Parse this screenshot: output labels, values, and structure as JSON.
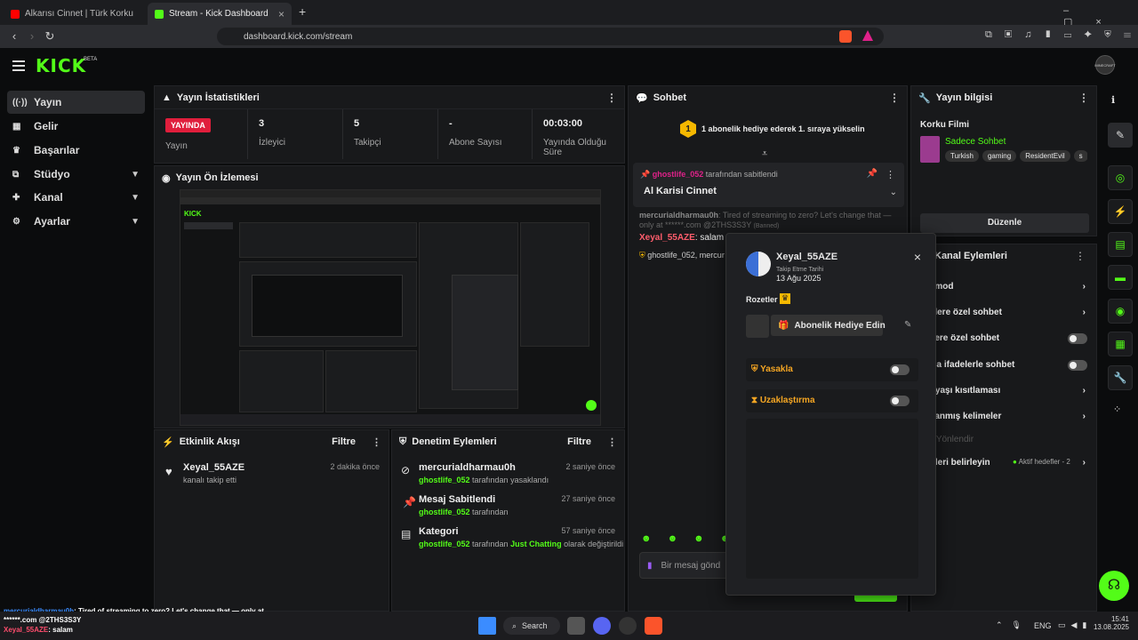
{
  "browser": {
    "tabs": [
      {
        "label": "Alkarısı Cinnet | Türk Korku Filmi Tek"
      },
      {
        "label": "Stream - Kick Dashboard"
      }
    ],
    "url": "dashboard.kick.com/stream",
    "new_tab": "+"
  },
  "header": {
    "logo": "KICK",
    "beta": "BETA",
    "avatar_label": "MINECRAFT"
  },
  "sidebar": {
    "items": [
      {
        "label": "Yayın",
        "icon": "broadcast-icon"
      },
      {
        "label": "Gelir",
        "icon": "revenue-icon"
      },
      {
        "label": "Başarılar",
        "icon": "trophy-icon"
      },
      {
        "label": "Stüdyo",
        "icon": "studio-icon"
      },
      {
        "label": "Kanal",
        "icon": "channel-icon"
      },
      {
        "label": "Ayarlar",
        "icon": "gear-icon"
      }
    ]
  },
  "stats": {
    "title": "Yayın İstatistikleri",
    "live": "YAYINDA",
    "live_label": "Yayın",
    "viewers": "3",
    "viewers_label": "İzleyici",
    "followers": "5",
    "followers_label": "Takipçi",
    "subs": "-",
    "subs_label": "Abone Sayısı",
    "duration": "00:03:00",
    "duration_label": "Yayında Olduğu Süre"
  },
  "preview": {
    "title": "Yayın Ön İzlemesi"
  },
  "activity": {
    "title": "Etkinlik Akışı",
    "filter": "Filtre",
    "items": [
      {
        "user": "Xeyal_55AZE",
        "desc": "kanalı takip etti",
        "time": "2 dakika önce"
      }
    ]
  },
  "moderation": {
    "title": "Denetim Eylemleri",
    "filter": "Filtre",
    "items": [
      {
        "title": "mercurialdharmau0h",
        "by": "ghostlife_052",
        "rest": " tarafından yasaklandı",
        "time": "2 saniye önce"
      },
      {
        "title": "Mesaj Sabitlendi",
        "by": "ghostlife_052",
        "rest": " tarafından",
        "time": "27 saniye önce"
      },
      {
        "title": "Kategori",
        "by": "ghostlife_052",
        "rest": " tarafından ",
        "category": "Just Chatting",
        "rest2": " olarak değiştirildi",
        "time": "57 saniye önce"
      }
    ]
  },
  "chat": {
    "title": "Sohbet",
    "gift_rank": "1",
    "gift_text": "1 abonelik hediye ederek 1. sıraya yükselin",
    "pinned_by": "ghostlife_052",
    "pinned_suffix": " tarafından sabitlendi",
    "pinned_msg": "Al Karisi Cinnet",
    "msg1_user": "mercurialdharmau0h",
    "msg1_text": ": Tired of streaming to zero? Let's change that — only at ******.com @2THS3S3Y",
    "msg1_tag": "(Banned)",
    "msg2_user": "Xeyal_55AZE",
    "msg2_text": ": salam",
    "msg3": "ghostlife_052, mercur",
    "input_placeholder": "Bir mesaj gönd"
  },
  "popup": {
    "user": "Xeyal_55AZE",
    "follow_label": "Takip Etme Tarihi",
    "follow_date": "13 Ağu 2025",
    "badges_label": "Rozetler",
    "gift_button": "Abonelik Hediye Edin",
    "ban": "Yasakla",
    "timeout": "Uzaklaştırma"
  },
  "streaminfo": {
    "title": "Yayın bilgisi",
    "stream_title": "Korku Filmi",
    "category": "Sadece Sohbet",
    "tags": [
      "Turkish",
      "gaming",
      "ResidentEvil",
      "s"
    ],
    "edit": "Düzenle"
  },
  "channel_actions": {
    "title": "Kanal Eylemleri",
    "items": [
      {
        "label": "ş mod",
        "type": "arrow"
      },
      {
        "label": "çilere özel sohbet",
        "type": "arrow"
      },
      {
        "label": "elere özel sohbet",
        "type": "toggle"
      },
      {
        "label": "zca ifadelerle sohbet",
        "type": "toggle"
      },
      {
        "label": "p yaşı kısıtlaması",
        "type": "arrow"
      },
      {
        "label": "klanmış kelimeler",
        "type": "arrow"
      },
      {
        "label": "ci Yönlendir",
        "type": "none"
      },
      {
        "label": "efleri belirleyin",
        "type": "goal"
      }
    ],
    "goal_status": "Aktif hedefler - 2"
  },
  "overlay_chat": {
    "line1_user": "mercurialdharmau0h",
    "line1_text": ": Tired of streaming to zero? Let's change that — only at",
    "line2": "******.com @2THS3S3Y",
    "line3_user": "Xeyal_55AZE",
    "line3_text": ": salam"
  },
  "taskbar": {
    "search": "Search",
    "lang": "ENG",
    "time": "15:41",
    "date": "13.08.2025"
  }
}
